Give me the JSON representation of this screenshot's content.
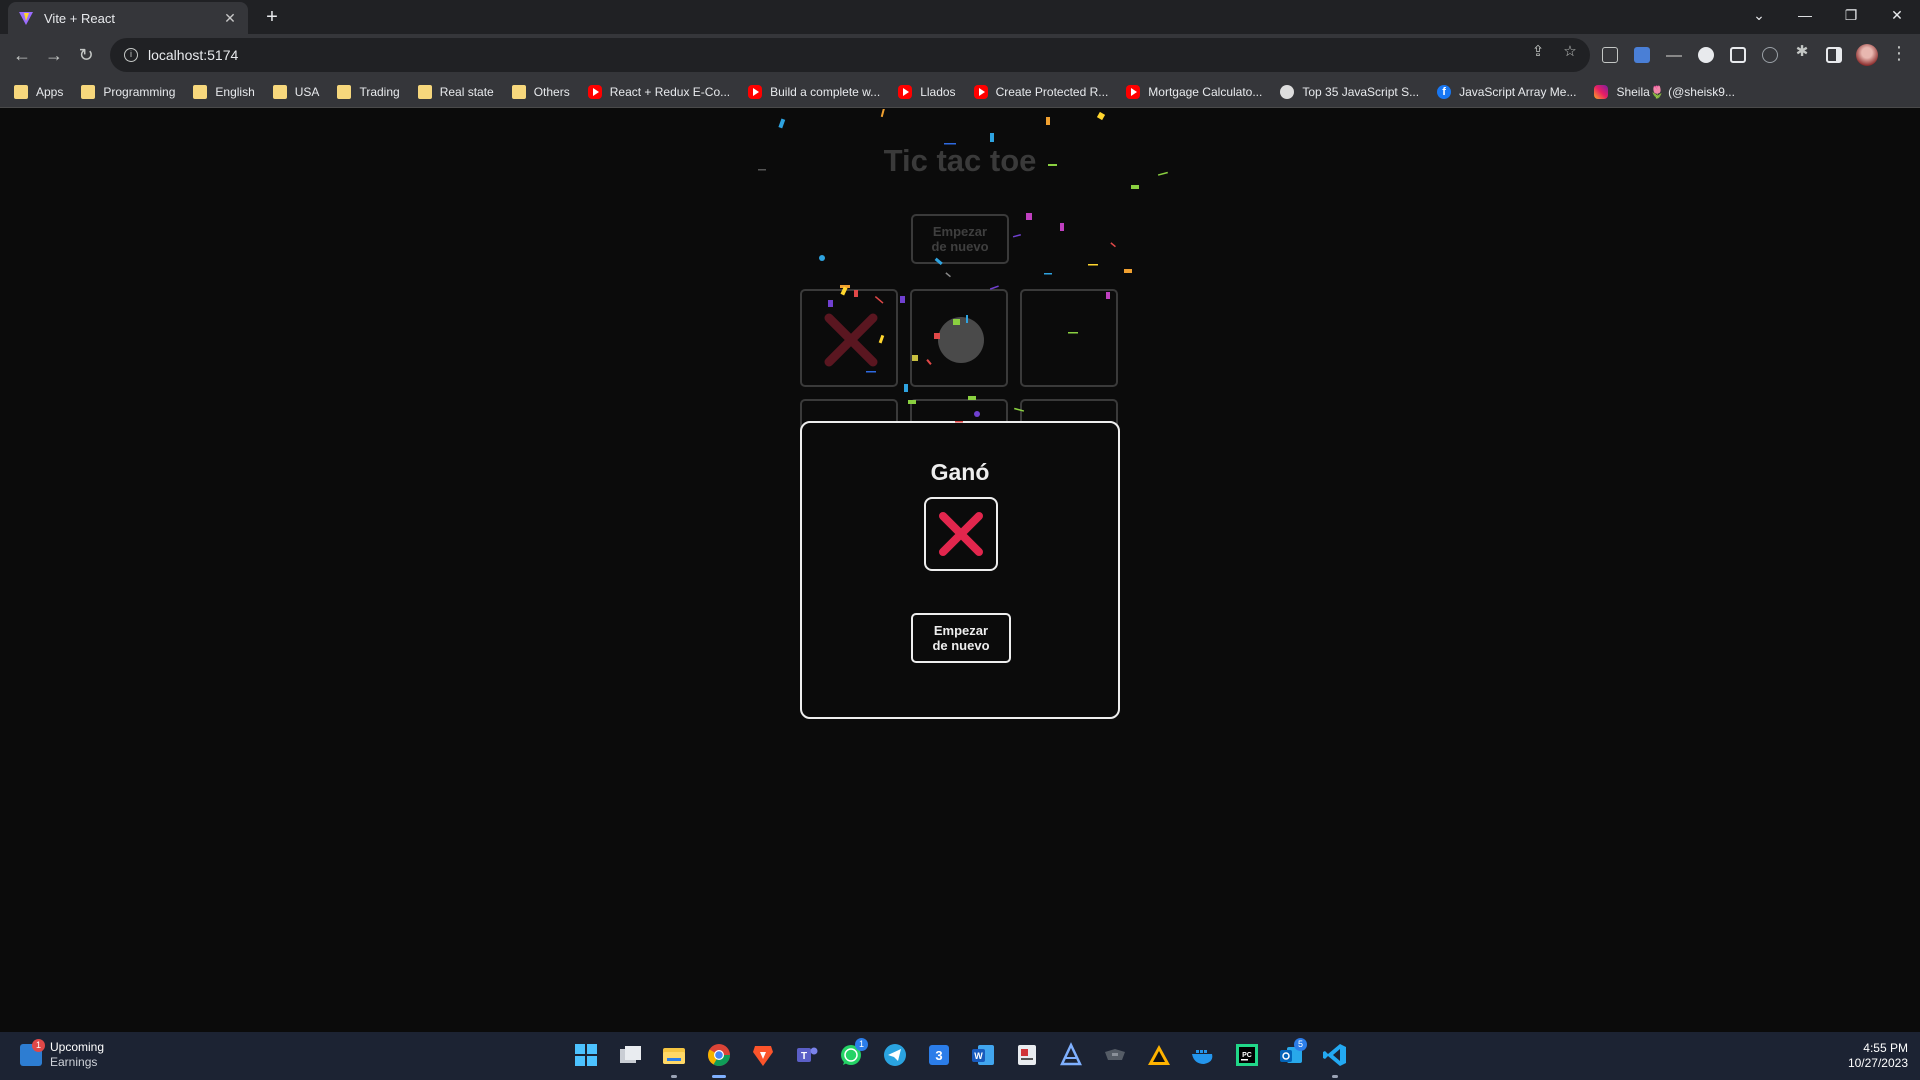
{
  "browser": {
    "tab_title": "Vite + React",
    "new_tab_label": "+",
    "url": "localhost:5174",
    "window_controls": [
      "⌄",
      "—",
      "❐",
      "✕"
    ]
  },
  "bookmarks": [
    {
      "label": "Apps",
      "icon": "folder-icon"
    },
    {
      "label": "Programming",
      "icon": "folder-icon"
    },
    {
      "label": "English",
      "icon": "folder-icon"
    },
    {
      "label": "USA",
      "icon": "folder-icon"
    },
    {
      "label": "Trading",
      "icon": "folder-icon"
    },
    {
      "label": "Real state",
      "icon": "folder-icon"
    },
    {
      "label": "Others",
      "icon": "folder-icon"
    },
    {
      "label": "React + Redux E-Co...",
      "icon": "youtube-icon"
    },
    {
      "label": "Build a complete w...",
      "icon": "youtube-icon"
    },
    {
      "label": "Llados",
      "icon": "youtube-icon"
    },
    {
      "label": "Create Protected R...",
      "icon": "youtube-icon"
    },
    {
      "label": "Mortgage Calculato...",
      "icon": "youtube-icon"
    },
    {
      "label": "Top 35 JavaScript S...",
      "icon": "github-icon"
    },
    {
      "label": "JavaScript Array Me...",
      "icon": "facebook-icon"
    },
    {
      "label": "Sheila🌷 (@sheisk9...",
      "icon": "instagram-icon"
    }
  ],
  "game": {
    "title": "Tic tac toe",
    "restart_label_line1": "Empezar",
    "restart_label_line2": "de nuevo",
    "board": [
      "x",
      "o",
      "",
      "",
      "",
      "",
      "",
      "",
      ""
    ],
    "colors": {
      "x_faded": "#5a1620",
      "x": "#e2264d",
      "o_faded": "#4a4a4a"
    }
  },
  "modal": {
    "title": "Ganó",
    "winner": "x",
    "restart_label_line1": "Empezar",
    "restart_label_line2": "de nuevo"
  },
  "taskbar": {
    "widget_title": "Upcoming",
    "widget_subtitle": "Earnings",
    "widget_badge": "1",
    "apps": [
      "windows-start-icon",
      "task-view-icon",
      "file-explorer-icon",
      "chrome-icon",
      "brave-icon",
      "teams-icon",
      "whatsapp-icon",
      "telegram-icon",
      "numbers-3-icon",
      "word-icon",
      "snipping-icon",
      "text-editor-icon",
      "terminal-icon",
      "vlc-icon",
      "docker-icon",
      "pycharm-icon",
      "outlook-icon",
      "vscode-icon"
    ],
    "whatsapp_badge": "1",
    "outlook_badge": "5",
    "time": "4:55 PM",
    "date": "10/27/2023"
  }
}
